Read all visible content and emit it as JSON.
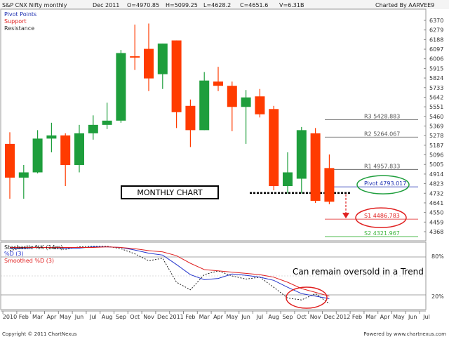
{
  "header": {
    "title": "S&P CNX Nifty monthly",
    "period": "Dec 2011",
    "open": "O=4970.85",
    "high": "H=5099.25",
    "low": "L=4628.2",
    "close": "C=4651.6",
    "volume": "V=6.31B",
    "charted_by": "Charted By AARVEE9"
  },
  "legend": {
    "pivot": "Pivot Points",
    "support": "Support",
    "resistance": "Resistance"
  },
  "annotations": {
    "monthly_chart": "MONTHLY CHART",
    "oversold": "Can remain oversold in a Trend"
  },
  "footer": {
    "copyright": "Copyright © 2011 ChartNexus",
    "powered": "Powered by www.chartnexus.com"
  },
  "colors": {
    "up": "#1e9e3c",
    "down": "#ff3b00",
    "pivot": "#1a2db0",
    "support": "#e02020",
    "s2": "#3cb43c",
    "resistance": "#555555",
    "k_line": "#222222",
    "d_line": "#2233cc",
    "smoothed_d": "#e02020"
  },
  "chart_data": [
    {
      "type": "candlestick",
      "title": "S&P CNX Nifty monthly",
      "y_ticks": [
        "6370",
        "6279",
        "6188",
        "6097",
        "6006",
        "5915",
        "5824",
        "5733",
        "5642",
        "5551",
        "5460",
        "5369",
        "5278",
        "5187",
        "5096",
        "5005",
        "4914",
        "4823",
        "4732",
        "4641",
        "4550",
        "4459",
        "4368"
      ],
      "ylim": [
        4368,
        6370
      ],
      "x_ticks": [
        "2010",
        "Feb",
        "Mar",
        "Apr",
        "May",
        "Jun",
        "Jul",
        "Aug",
        "Sep",
        "Oct",
        "Nov",
        "Dec",
        "2011",
        "Feb",
        "Mar",
        "Apr",
        "May",
        "Jun",
        "Jul",
        "Aug",
        "Sep",
        "Oct",
        "Nov",
        "Dec",
        "2012",
        "Feb",
        "Mar",
        "Apr",
        "May",
        "Jun",
        "Jul"
      ],
      "candles": [
        {
          "open": 5200,
          "high": 5310,
          "low": 4680,
          "close": 4880
        },
        {
          "open": 4880,
          "high": 5000,
          "low": 4680,
          "close": 4930
        },
        {
          "open": 4930,
          "high": 5330,
          "low": 4920,
          "close": 5250
        },
        {
          "open": 5250,
          "high": 5400,
          "low": 5120,
          "close": 5280
        },
        {
          "open": 5280,
          "high": 5300,
          "low": 4800,
          "close": 5000
        },
        {
          "open": 5000,
          "high": 5380,
          "low": 4930,
          "close": 5300
        },
        {
          "open": 5300,
          "high": 5470,
          "low": 5240,
          "close": 5380
        },
        {
          "open": 5380,
          "high": 5590,
          "low": 5340,
          "close": 5420
        },
        {
          "open": 5420,
          "high": 6090,
          "low": 5400,
          "close": 6060
        },
        {
          "open": 6030,
          "high": 6330,
          "low": 5900,
          "close": 6020
        },
        {
          "open": 6100,
          "high": 6340,
          "low": 5700,
          "close": 5820
        },
        {
          "open": 5860,
          "high": 6150,
          "low": 5720,
          "close": 6150
        },
        {
          "open": 6180,
          "high": 6180,
          "low": 5350,
          "close": 5500
        },
        {
          "open": 5560,
          "high": 5620,
          "low": 5170,
          "close": 5330
        },
        {
          "open": 5330,
          "high": 5880,
          "low": 5330,
          "close": 5800
        },
        {
          "open": 5790,
          "high": 5930,
          "low": 5700,
          "close": 5750
        },
        {
          "open": 5750,
          "high": 5790,
          "low": 5320,
          "close": 5550
        },
        {
          "open": 5550,
          "high": 5710,
          "low": 5200,
          "close": 5640
        },
        {
          "open": 5650,
          "high": 5720,
          "low": 5450,
          "close": 5480
        },
        {
          "open": 5530,
          "high": 5560,
          "low": 4760,
          "close": 4800
        },
        {
          "open": 4800,
          "high": 5120,
          "low": 4730,
          "close": 4930
        },
        {
          "open": 4870,
          "high": 5360,
          "low": 4730,
          "close": 5330
        },
        {
          "open": 5300,
          "high": 5350,
          "low": 4640,
          "close": 4660
        },
        {
          "open": 4970.85,
          "high": 5099.25,
          "low": 4628.2,
          "close": 4651.6
        }
      ],
      "levels": [
        {
          "name": "R3",
          "label": "R3 5428.883",
          "value": 5428.883,
          "kind": "resistance"
        },
        {
          "name": "R2",
          "label": "R2 5264.067",
          "value": 5264.067,
          "kind": "resistance"
        },
        {
          "name": "R1",
          "label": "R1 4957.833",
          "value": 4957.833,
          "kind": "resistance"
        },
        {
          "name": "Pivot",
          "label": "Pivot 4793.017",
          "value": 4793.017,
          "kind": "pivot"
        },
        {
          "name": "S1",
          "label": "S1 4486.783",
          "value": 4486.783,
          "kind": "support"
        },
        {
          "name": "S2",
          "label": "S2 4321.967",
          "value": 4321.967,
          "kind": "s2"
        }
      ],
      "support_line_value": 4735
    },
    {
      "type": "line",
      "title": "Stochastic %K (14m)",
      "ylim": [
        0,
        100
      ],
      "y_ticks": [
        "80%",
        "20%"
      ],
      "series": [
        {
          "name": "Stochastic %K (14m)",
          "style": "dashed",
          "values": [
            90,
            95,
            96,
            94,
            92,
            96,
            97,
            97,
            93,
            85,
            74,
            78,
            40,
            28,
            52,
            58,
            50,
            45,
            48,
            32,
            15,
            12,
            22,
            6
          ]
        },
        {
          "name": "%D (3)",
          "style": "solid",
          "values": [
            94,
            94,
            95,
            95,
            94,
            94,
            96,
            96,
            95,
            91,
            86,
            83,
            68,
            52,
            44,
            46,
            53,
            51,
            48,
            43,
            32,
            22,
            18,
            14
          ]
        },
        {
          "name": "Smoothed %D (3)",
          "style": "solid",
          "values": [
            95,
            95,
            95,
            95,
            95,
            95,
            95,
            96,
            95,
            93,
            90,
            88,
            82,
            70,
            60,
            58,
            56,
            54,
            52,
            48,
            40,
            30,
            24,
            18
          ]
        }
      ]
    }
  ]
}
